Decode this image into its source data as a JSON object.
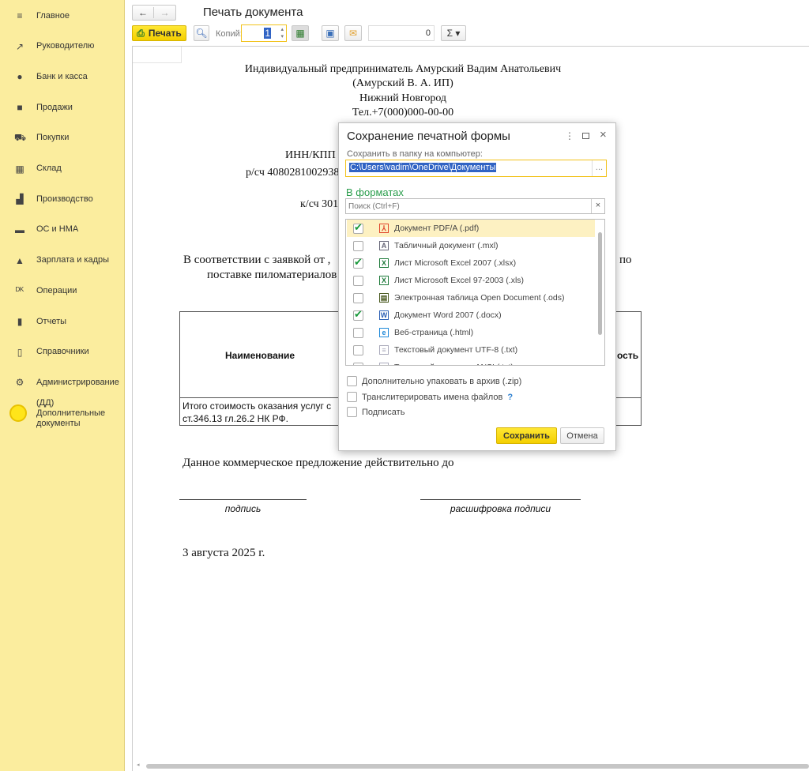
{
  "sidebar": {
    "items": [
      {
        "label": "Главное",
        "icon": "menu-icon",
        "glyph": "≡"
      },
      {
        "label": "Руководителю",
        "icon": "trend-icon",
        "glyph": "↗"
      },
      {
        "label": "Банк и касса",
        "icon": "ruble-coin-icon",
        "glyph": "●"
      },
      {
        "label": "Продажи",
        "icon": "shopping-bag-icon",
        "glyph": "■"
      },
      {
        "label": "Покупки",
        "icon": "cart-icon",
        "glyph": "⛟"
      },
      {
        "label": "Склад",
        "icon": "warehouse-icon",
        "glyph": "▦"
      },
      {
        "label": "Производство",
        "icon": "factory-icon",
        "glyph": "▟"
      },
      {
        "label": "ОС и НМА",
        "icon": "truck-icon",
        "glyph": "▬"
      },
      {
        "label": "Зарплата и кадры",
        "icon": "person-icon",
        "glyph": "▲"
      },
      {
        "label": "Операции",
        "icon": "debit-credit-icon",
        "glyph": "ᴰᴷ"
      },
      {
        "label": "Отчеты",
        "icon": "bar-chart-icon",
        "glyph": "▮"
      },
      {
        "label": "Справочники",
        "icon": "books-icon",
        "glyph": "▯"
      },
      {
        "label": "Администрирование",
        "icon": "gear-icon",
        "glyph": "⚙"
      },
      {
        "label": "(ДД) Дополнительные документы",
        "icon": "yellow-circle-icon",
        "glyph": ""
      }
    ]
  },
  "header": {
    "title": "Печать документа",
    "back": "←",
    "forward": "→"
  },
  "toolbar": {
    "print_label": "Печать",
    "copies_label": "Копий:",
    "copies_value": "1",
    "sum_value": "0",
    "sigma": "Σ ▾"
  },
  "document": {
    "lines": [
      "Индивидуальный предприниматель Амурский Вадим Анатольевич",
      "(Амурский В. А. ИП)",
      "Нижний Новгород",
      "Тел.+7(000)000-00-00"
    ],
    "inn": "ИНН/КПП",
    "account": "р/сч 4080281002938",
    "corr_account": "к/сч 301",
    "para1_start": "В соответствии с заявкой от ,",
    "para1_end": "по",
    "para2_start": "поставке пиломатериалов",
    "col_name": "Наименование",
    "col_cost_tail": "ость",
    "total_line1": "Итого стоимость оказания услуг с",
    "total_line2": "ст.346.13 гл.26.2 НК РФ.",
    "validity": "Данное коммерческое предложение действительно до",
    "signature": "подпись",
    "signature_decode": "расшифровка подписи",
    "date": "3 августа 2025 г."
  },
  "dialog": {
    "title": "Сохранение печатной формы",
    "folder_label": "Сохранить в папку на компьютер:",
    "folder_value": "C:\\Users\\vadim\\OneDrive\\Документы",
    "browse": "...",
    "formats_label": "В форматах",
    "search_placeholder": "Поиск (Ctrl+F)",
    "clear": "×",
    "formats": [
      {
        "label": "Документ PDF/A (.pdf)",
        "checked": true,
        "icon": "pdf-icon",
        "glyph": "⅄",
        "color": "#e0452b"
      },
      {
        "label": "Табличный документ (.mxl)",
        "checked": false,
        "icon": "mxl-icon",
        "glyph": "A",
        "color": "#667"
      },
      {
        "label": "Лист Microsoft Excel 2007 (.xlsx)",
        "checked": true,
        "icon": "excel-icon",
        "glyph": "X",
        "color": "#1d7a3a"
      },
      {
        "label": "Лист Microsoft Excel 97-2003 (.xls)",
        "checked": false,
        "icon": "excel-icon",
        "glyph": "X",
        "color": "#1d7a3a"
      },
      {
        "label": "Электронная таблица Open Document (.ods)",
        "checked": false,
        "icon": "ods-icon",
        "glyph": "▤",
        "color": "#4a5a20"
      },
      {
        "label": "Документ Word 2007 (.docx)",
        "checked": true,
        "icon": "word-icon",
        "glyph": "W",
        "color": "#2b5fb4"
      },
      {
        "label": "Веб-страница (.html)",
        "checked": false,
        "icon": "edge-icon",
        "glyph": "e",
        "color": "#1e88d8"
      },
      {
        "label": "Текстовый документ UTF-8 (.txt)",
        "checked": false,
        "icon": "text-file-icon",
        "glyph": "≡",
        "color": "#aab"
      },
      {
        "label": "Текстовый документ ANSI (.txt)",
        "checked": false,
        "icon": "text-file-icon",
        "glyph": "≡",
        "color": "#aab"
      }
    ],
    "zip_label": "Дополнительно упаковать в архив (.zip)",
    "translit_label": "Транслитерировать имена файлов",
    "help": "?",
    "sign_label": "Подписать",
    "save": "Сохранить",
    "cancel": "Отмена"
  },
  "colors": {
    "sidebar": "#fbed9e",
    "accent_yellow": "#f4cf00",
    "green": "#2a9d4c",
    "selection": "#fdf1c2"
  }
}
